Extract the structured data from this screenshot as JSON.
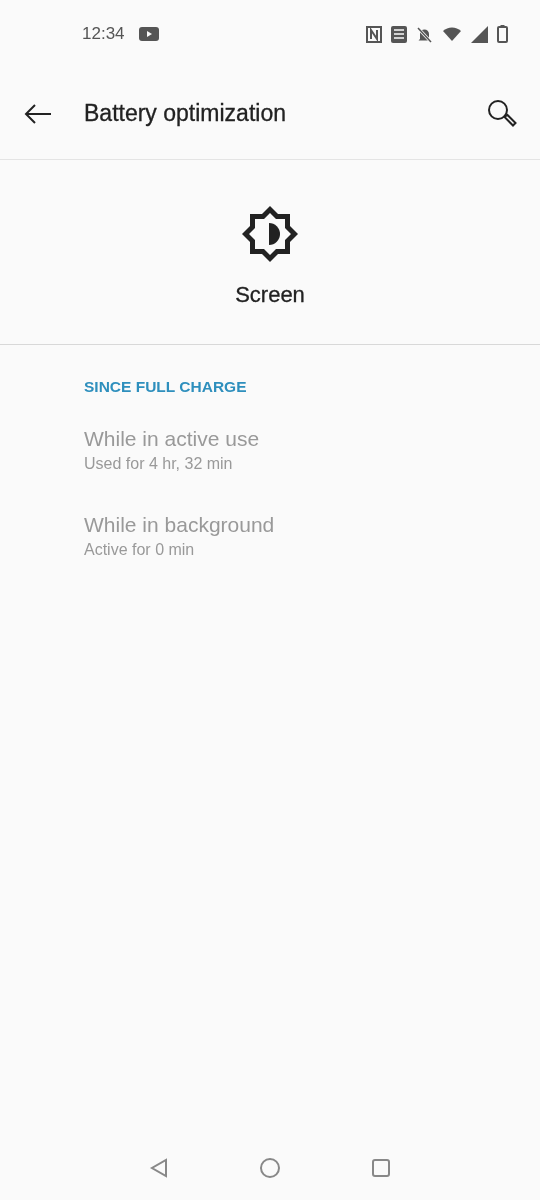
{
  "status_bar": {
    "time": "12:34"
  },
  "toolbar": {
    "title": "Battery optimization"
  },
  "header": {
    "title": "Screen"
  },
  "section": {
    "title": "SINCE FULL CHARGE"
  },
  "items": [
    {
      "title": "While in active use",
      "summary": "Used for 4 hr, 32 min",
      "disabled": true
    },
    {
      "title": "While in background",
      "summary": "Active for 0 min",
      "disabled": true
    }
  ]
}
